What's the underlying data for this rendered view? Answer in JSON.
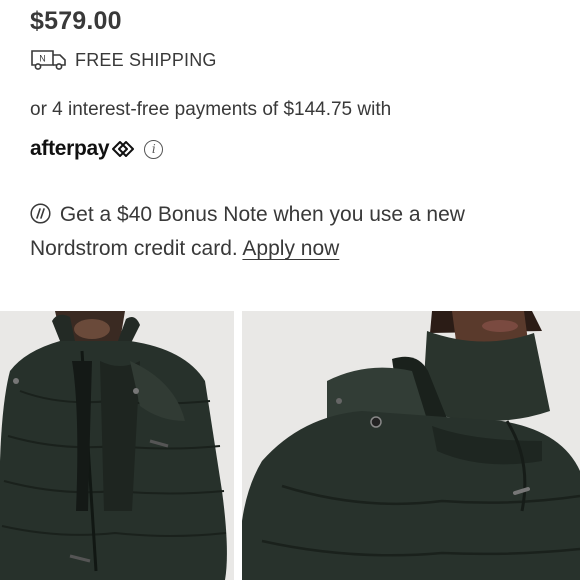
{
  "product": {
    "price": "$579.00"
  },
  "shipping": {
    "label": "FREE SHIPPING",
    "icon": "delivery-truck-icon",
    "truck_letter": "N"
  },
  "payments": {
    "installments_text": "or 4 interest-free payments of $144.75 with",
    "provider_logo": "afterpay",
    "info_icon": "info-icon"
  },
  "promo": {
    "text": "Get a $40 Bonus Note when you use a new Nordstrom credit card.",
    "link_label": "Apply now",
    "icon": "nordstrom-note-icon"
  },
  "gallery": {
    "images": [
      {
        "icon": "product-photo-front"
      },
      {
        "icon": "product-photo-collar-detail"
      }
    ]
  },
  "colors": {
    "text": "#393939",
    "jacket": "#2a342d",
    "background": "#ffffff"
  }
}
